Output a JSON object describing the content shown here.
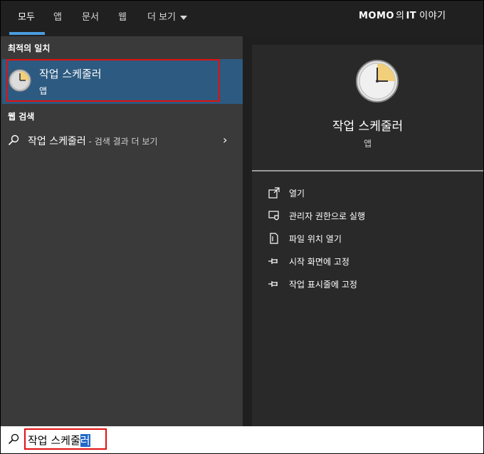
{
  "tabs": {
    "all": "모두",
    "app": "앱",
    "documents": "문서",
    "web": "웹",
    "more": "더 보기"
  },
  "brand": {
    "part1": "MOMO",
    "part2": "의",
    "part3": "IT",
    "part4": "이야기"
  },
  "left": {
    "best_match_title": "최적의 일치",
    "best_match": {
      "name": "작업 스케줄러",
      "type": "앱"
    },
    "web_search_title": "웹 검색",
    "web_item": {
      "query": "작업 스케줄러",
      "suffix": " - 검색 결과 더 보기"
    }
  },
  "right": {
    "name": "작업 스케줄러",
    "type": "앱",
    "actions": [
      {
        "label": "열기",
        "icon": "open-icon"
      },
      {
        "label": "관리자 권한으로 실행",
        "icon": "shield-icon"
      },
      {
        "label": "파일 위치 열기",
        "icon": "file-location-icon"
      },
      {
        "label": "시작 화면에 고정",
        "icon": "pin-icon"
      },
      {
        "label": "작업 표시줄에 고정",
        "icon": "pin-icon"
      }
    ]
  },
  "search": {
    "typed": "작업 스케줄",
    "selected": "러"
  },
  "colors": {
    "selected_item_bg": "#2d5a80",
    "highlight_border": "#e01010",
    "tab_underline": "#4a9de0"
  }
}
